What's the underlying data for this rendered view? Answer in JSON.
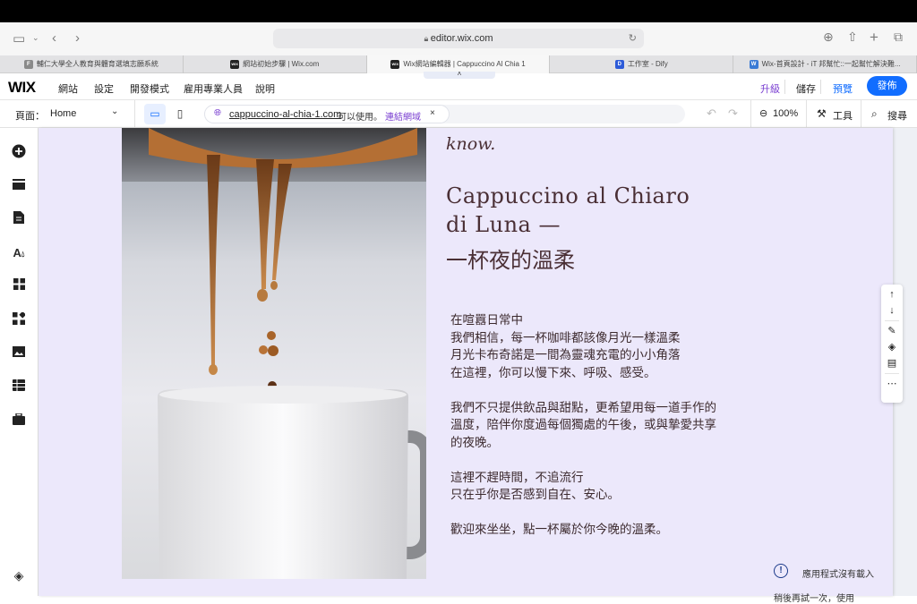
{
  "browser": {
    "url": "editor.wix.com",
    "tabs": [
      {
        "icon": "F",
        "label": "輔仁大學全人教育與體育選填志願系統"
      },
      {
        "icon": "WIX",
        "label": "網站初始步驟 | Wix.com"
      },
      {
        "icon": "WIX",
        "label": "Wix網站編輯器 | Cappuccino Al Chia 1"
      },
      {
        "icon": "D",
        "label": "工作室 - Dify"
      },
      {
        "icon": "W",
        "label": "Wix-首頁設計 - iT 邦幫忙::一起幫忙解決難..."
      }
    ]
  },
  "wix": {
    "logo": "WIX",
    "menu": [
      "網站",
      "設定",
      "開發模式",
      "雇用專業人員",
      "說明"
    ],
    "upgrade": "升級",
    "save": "儲存",
    "preview": "預覽",
    "publish": "發佈",
    "page_label": "頁面：",
    "page_value": "Home",
    "domain": "cappuccino-al-chia-1.com",
    "domain_status": "可以使用。",
    "connect_domain": "連結網域",
    "zoom": "100%",
    "tools": "工具",
    "search": "搜尋"
  },
  "content": {
    "script_word": "know.",
    "title_line1": "Cappuccino al Chiaro",
    "title_line2": "di Luna —",
    "title_zh": "一杯夜的溫柔",
    "paragraphs": [
      [
        "在喧囂日常中",
        "我們相信，每一杯咖啡都該像月光一樣溫柔",
        "月光卡布奇諾是一間為靈魂充電的小小角落",
        "在這裡，你可以慢下來、呼吸、感受。"
      ],
      [
        "我們不只提供飲品與甜點，更希望用每一道手作的",
        "溫度，陪伴你度過每個獨處的午後，或與摯愛共享",
        "的夜晚。"
      ],
      [
        "這裡不趕時間，不追流行",
        "只在乎你是否感到自在、安心。"
      ],
      [
        "歡迎來坐坐，點一杯屬於你今晚的溫柔。"
      ]
    ]
  },
  "notice": {
    "line1": "應用程式沒有載入",
    "line2": "稍後再試一次，使用"
  },
  "colors": {
    "accent": "#116dff",
    "upgrade": "#7a3fd1",
    "page_bg": "#ece8fb",
    "heading": "#4a2f35"
  }
}
